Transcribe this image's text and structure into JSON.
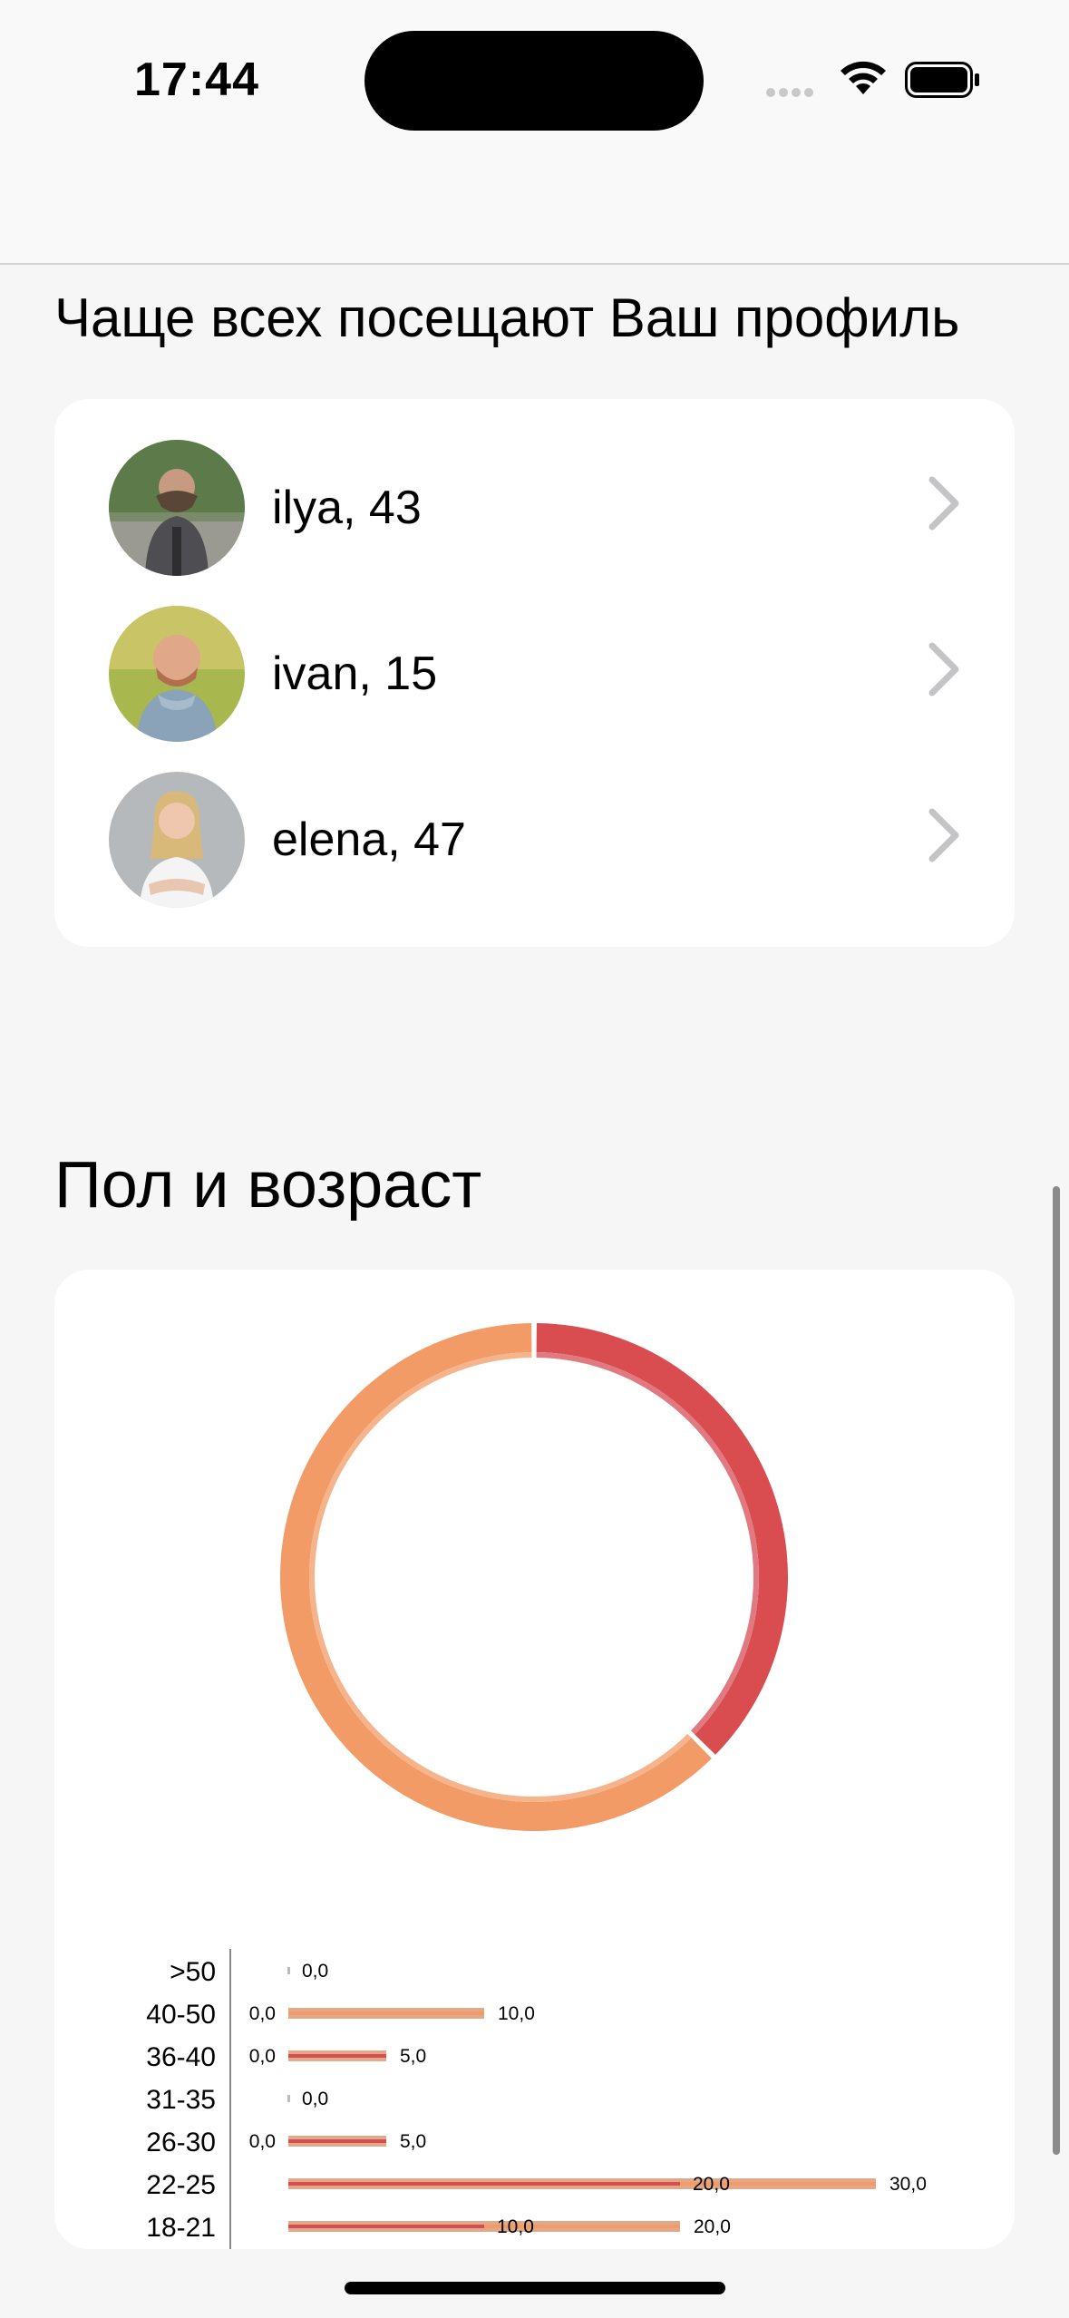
{
  "status_bar": {
    "time": "17:44"
  },
  "sections": {
    "visitors_title": "Чаще всех посещают Ваш профиль",
    "gender_age_title": "Пол и возраст"
  },
  "visitors": [
    {
      "name_age": "ilya, 43"
    },
    {
      "name_age": "ivan, 15"
    },
    {
      "name_age": "elena, 47"
    }
  ],
  "colors": {
    "male": "#d94c4f",
    "female": "#f29b67",
    "male_light": "#e07a80",
    "female_light": "#f5b48c",
    "bar_outline": "#e0a98a"
  },
  "chart_data": [
    {
      "type": "pie",
      "subtype": "donut",
      "values": [
        37.5,
        62.5
      ],
      "colors": [
        "#d94c4f",
        "#f29b67"
      ]
    },
    {
      "type": "bar",
      "orientation": "horizontal",
      "stacked": true,
      "categories": [
        ">50",
        "40-50",
        "36-40",
        "31-35",
        "26-30",
        "22-25",
        "18-21"
      ],
      "series": [
        {
          "values": [
            0,
            0,
            5,
            0,
            5,
            20,
            10
          ],
          "color": "#d94c4f"
        },
        {
          "values": [
            0,
            10,
            0,
            0,
            0,
            10,
            10
          ],
          "color": "#f29b67"
        }
      ],
      "labels": [
        {
          "left": "",
          "right": "0,0"
        },
        {
          "left": "0,0",
          "right": "10,0"
        },
        {
          "left": "0,0",
          "right": "5,0"
        },
        {
          "left": "",
          "right": "0,0"
        },
        {
          "left": "0,0",
          "right": "5,0"
        },
        {
          "mid": "20,0",
          "right": "30,0"
        },
        {
          "mid": "10,0",
          "right": "20,0"
        }
      ],
      "xlim": [
        0,
        34
      ]
    }
  ]
}
